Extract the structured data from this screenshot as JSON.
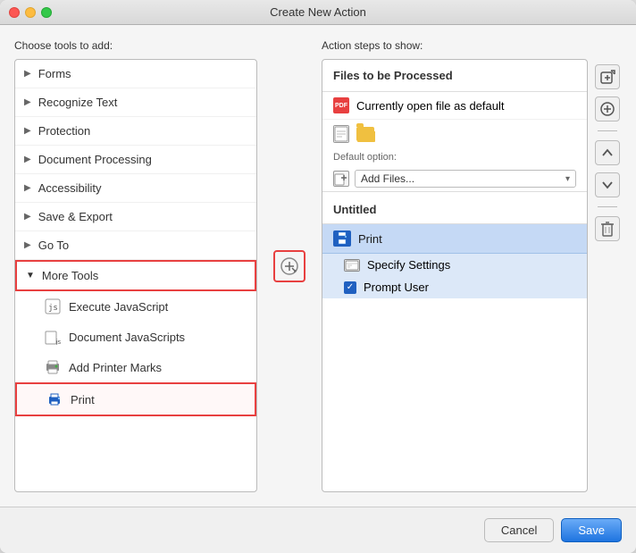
{
  "window": {
    "title": "Create New Action"
  },
  "left_panel": {
    "label": "Choose tools to add:",
    "items": [
      {
        "id": "forms",
        "label": "Forms",
        "expanded": false,
        "arrow": "▶"
      },
      {
        "id": "recognize-text",
        "label": "Recognize Text",
        "expanded": false,
        "arrow": "▶"
      },
      {
        "id": "protection",
        "label": "Protection",
        "expanded": false,
        "arrow": "▶"
      },
      {
        "id": "document-processing",
        "label": "Document Processing",
        "expanded": false,
        "arrow": "▶"
      },
      {
        "id": "accessibility",
        "label": "Accessibility",
        "expanded": false,
        "arrow": "▶"
      },
      {
        "id": "save-export",
        "label": "Save & Export",
        "expanded": false,
        "arrow": "▶"
      },
      {
        "id": "go-to",
        "label": "Go To",
        "expanded": false,
        "arrow": "▶"
      },
      {
        "id": "more-tools",
        "label": "More Tools",
        "expanded": true,
        "arrow": "▼"
      }
    ],
    "more_tools_items": [
      {
        "id": "execute-js",
        "label": "Execute JavaScript"
      },
      {
        "id": "document-js",
        "label": "Document JavaScripts"
      },
      {
        "id": "add-printer-marks",
        "label": "Add Printer Marks"
      },
      {
        "id": "print",
        "label": "Print"
      }
    ]
  },
  "center": {
    "button_title": "Add to action"
  },
  "right_panel": {
    "label": "Action steps to show:",
    "files_section": {
      "header": "Files to be Processed",
      "current_file_label": "Currently open file as default",
      "default_option_label": "Default option:",
      "default_option_value": "Add Files...",
      "doc_icon": "📄",
      "folder_icon": "📁"
    },
    "untitled_section": {
      "header": "Untitled",
      "print_item": {
        "label": "Print"
      },
      "sub_items": [
        {
          "id": "specify-settings",
          "label": "Specify Settings"
        },
        {
          "id": "prompt-user",
          "label": "Prompt User",
          "checked": true
        }
      ]
    }
  },
  "toolbar": {
    "buttons": [
      {
        "id": "add-content",
        "icon": "⊕",
        "label": "Add content"
      },
      {
        "id": "add-item",
        "icon": "⊕",
        "label": "Add item"
      },
      {
        "id": "separator",
        "type": "divider"
      },
      {
        "id": "move-up",
        "icon": "↑",
        "label": "Move up"
      },
      {
        "id": "move-down",
        "icon": "↓",
        "label": "Move down"
      },
      {
        "id": "separator2",
        "type": "divider"
      },
      {
        "id": "delete",
        "icon": "🗑",
        "label": "Delete"
      }
    ]
  },
  "footer": {
    "cancel_label": "Cancel",
    "save_label": "Save"
  }
}
